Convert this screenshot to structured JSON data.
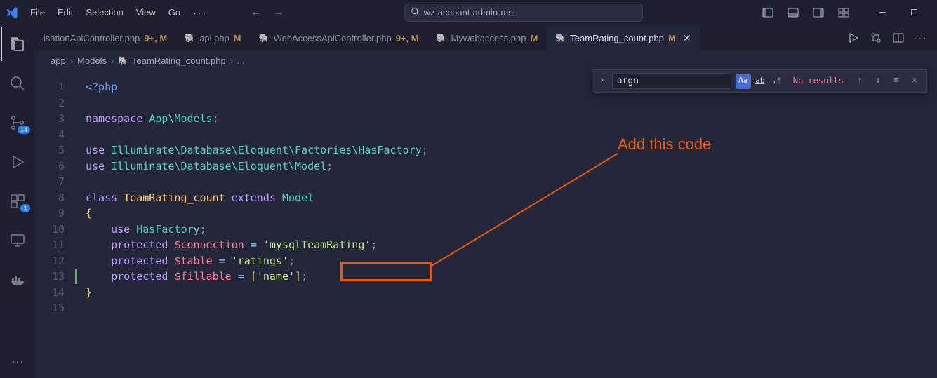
{
  "menu": {
    "items": [
      "File",
      "Edit",
      "Selection",
      "View",
      "Go"
    ],
    "ellipsis": "···"
  },
  "search_center": "wz-account-admin-ms",
  "tabs": [
    {
      "label": "isationApiController.php",
      "suffix": "9+, M",
      "active": false
    },
    {
      "label": "api.php",
      "suffix": "M",
      "active": false
    },
    {
      "label": "WebAccessApiController.php",
      "suffix": "9+, M",
      "active": false
    },
    {
      "label": "Mywebaccess.php",
      "suffix": "M",
      "active": false
    },
    {
      "label": "TeamRating_count.php",
      "suffix": "M",
      "active": true
    }
  ],
  "breadcrumb": {
    "parts": [
      "app",
      "Models",
      "TeamRating_count.php",
      "..."
    ]
  },
  "activity_badges": {
    "scm": "14",
    "ext": "1"
  },
  "find": {
    "value": "orgn",
    "results": "No results",
    "case_sensitive_active": true
  },
  "annotation": {
    "label": "Add this code"
  },
  "code": {
    "lines": [
      "<?php",
      "",
      "namespace App\\Models;",
      "",
      "use Illuminate\\Database\\Eloquent\\Factories\\HasFactory;",
      "use Illuminate\\Database\\Eloquent\\Model;",
      "",
      "class TeamRating_count extends Model",
      "{",
      "    use HasFactory;",
      "    protected $connection = 'mysqlTeamRating';",
      "    protected $table = 'ratings';",
      "    protected $fillable = ['name'];",
      "}",
      ""
    ]
  }
}
